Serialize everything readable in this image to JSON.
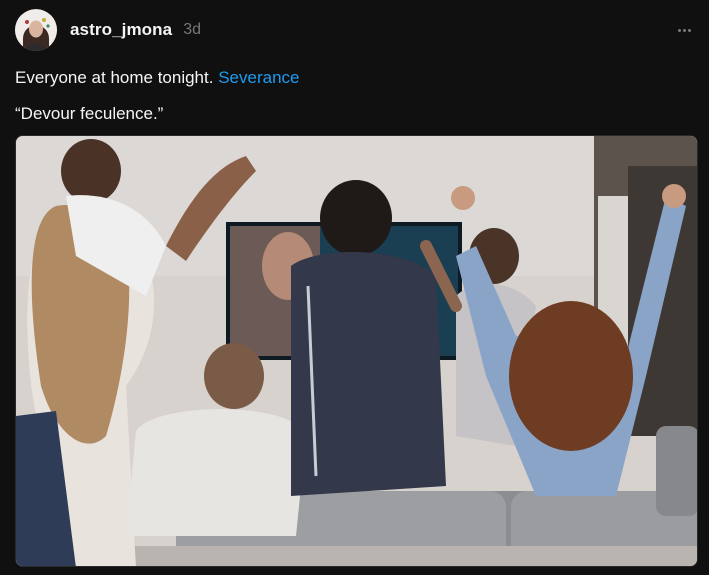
{
  "post": {
    "author": {
      "username": "astro_jmona",
      "avatar_icon": "avatar-portrait"
    },
    "timestamp": "3d",
    "more_icon": "more-horizontal-icon",
    "caption": {
      "text_prefix": "Everyone at home tonight.",
      "tag": "Severance",
      "quote": "“Devour feculence.”"
    },
    "media": {
      "icon": "video-still",
      "alt_scene": ""
    }
  },
  "colors": {
    "background": "#101010",
    "text": "#f3f5f7",
    "muted": "#777777",
    "link": "#1e9bf0"
  }
}
